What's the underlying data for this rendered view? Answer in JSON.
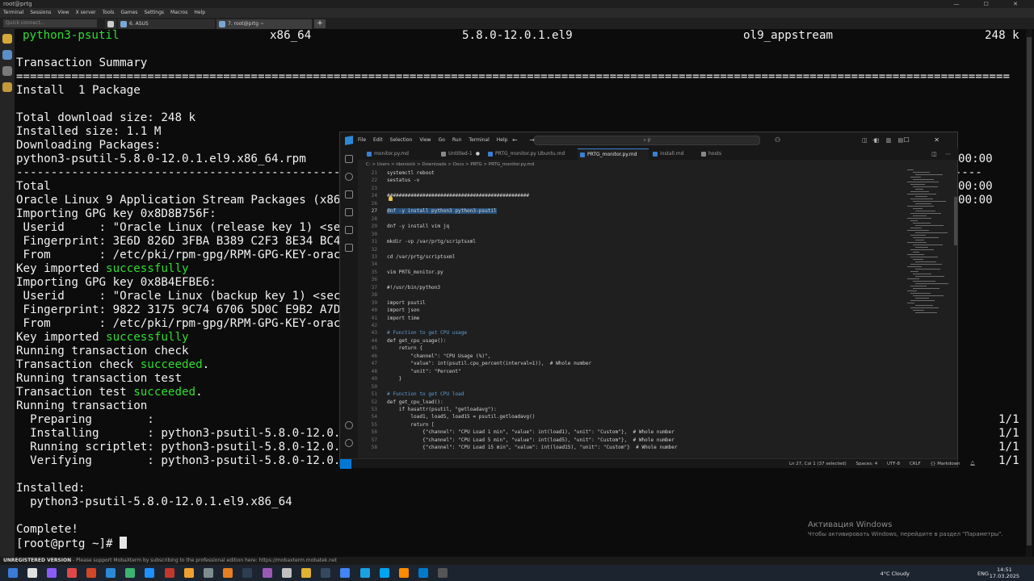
{
  "moba": {
    "title": "root@prtg",
    "menu": [
      "Terminal",
      "Sessions",
      "View",
      "X server",
      "Tools",
      "Games",
      "Settings",
      "Macros",
      "Help"
    ],
    "quick_connect_placeholder": "Quick connect...",
    "tabs": [
      {
        "label": "6. ASUS"
      },
      {
        "label": "7. root@prtg ~"
      }
    ],
    "status_label": "UNREGISTERED VERSION",
    "status_text": "  -  Please support MobaXterm by subscribing to the professional edition here:  https://mobaxterm.mobatek.net"
  },
  "terminal": {
    "pkg_name": "python3-psutil",
    "pkg_arch": "x86_64",
    "pkg_version": "5.8.0-12.0.1.el9",
    "pkg_repo": "ol9_appstream",
    "pkg_size": "248 k",
    "lines": [
      "",
      "Transaction Summary",
      "================================================================================================================================================",
      "Install  1 Package",
      "",
      "Total download size: 248 k",
      "Installed size: 1.1 M",
      "Downloading Packages:",
      "python3-psutil-5.8.0-12.0.1.el9.x86_64.rpm",
      "--------------------------------------------------------------------------------------------------------------------------------------------",
      "Total",
      "Oracle Linux 9 Application Stream Packages (x86",
      "Importing GPG key 0x8D8B756F:",
      " Userid     : \"Oracle Linux (release key 1) <sec",
      " Fingerprint: 3E6D 826D 3FBA B389 C2F3 8E34 BC4",
      " From       : /etc/pki/rpm-gpg/RPM-GPG-KEY-orac",
      "Key imported ",
      "Importing GPG key 0x8B4EFBE6:",
      " Userid     : \"Oracle Linux (backup key 1) <sec",
      " Fingerprint: 9822 3175 9C74 6706 5D0C E9B2 A7D",
      " From       : /etc/pki/rpm-gpg/RPM-GPG-KEY-orac",
      "Key imported ",
      "Running transaction check",
      "Transaction check ",
      "Running transaction test",
      "Transaction test ",
      "Running transaction",
      "  Preparing        :",
      "  Installing       : python3-psutil-5.8.0-12.0.",
      "  Running scriptlet: python3-psutil-5.8.0-12.0.",
      "  Verifying        : python3-psutil-5.8.0-12.0.",
      "",
      "Installed:",
      "  python3-psutil-5.8.0-12.0.1.el9.x86_64",
      "",
      "Complete!",
      "[root@prtg ~]# "
    ],
    "word_successfully": "successfully",
    "word_succeeded": "succeeded",
    "period": ".",
    "right_times": [
      "00:00",
      "00:00",
      "00:00"
    ],
    "right_counts": [
      "1/1",
      "1/1",
      "1/1",
      "1/1"
    ]
  },
  "vscode": {
    "menu": [
      "File",
      "Edit",
      "Selection",
      "View",
      "Go",
      "Run",
      "Terminal",
      "Help"
    ],
    "nav": "← →",
    "search_text": "⌕ p",
    "window_controls": "— ☐ ✕",
    "layout_controls": "◫ ◧ ▥ ▤",
    "tabs": [
      {
        "label": "monitor.py.md",
        "modified": false
      },
      {
        "label": "Untitled-1",
        "modified": true
      },
      {
        "label": "PRTG_monitor.py Ubuntu.md",
        "modified": false
      },
      {
        "label": "PRTG_monitor.py.md",
        "modified": false,
        "active": true
      },
      {
        "label": "install.md",
        "modified": false
      },
      {
        "label": "hosts",
        "modified": false
      }
    ],
    "breadcrumb": "C: > Users > idenisick > Downloads > Docs > PRTG > PRTG_monitor.py.md",
    "code": [
      {
        "n": "21",
        "t": "systemctl reboot",
        "k": ""
      },
      {
        "n": "22",
        "t": "sestatus -v",
        "k": ""
      },
      {
        "n": "23",
        "t": "",
        "k": ""
      },
      {
        "n": "24",
        "t": "################################################",
        "k": ""
      },
      {
        "n": "26",
        "t": "",
        "k": ""
      },
      {
        "n": "27",
        "t": "dnf -y install python3 python3-psutil",
        "k": "sel"
      },
      {
        "n": "28",
        "t": "",
        "k": ""
      },
      {
        "n": "29",
        "t": "dnf -y install vim jq",
        "k": ""
      },
      {
        "n": "30",
        "t": "",
        "k": ""
      },
      {
        "n": "31",
        "t": "mkdir -vp /var/prtg/scriptsxml",
        "k": ""
      },
      {
        "n": "32",
        "t": "",
        "k": ""
      },
      {
        "n": "33",
        "t": "cd /var/prtg/scriptsxml",
        "k": ""
      },
      {
        "n": "34",
        "t": "",
        "k": ""
      },
      {
        "n": "35",
        "t": "vim PRTG_monitor.py",
        "k": ""
      },
      {
        "n": "36",
        "t": "",
        "k": ""
      },
      {
        "n": "37",
        "t": "#!/usr/bin/python3",
        "k": ""
      },
      {
        "n": "38",
        "t": "",
        "k": ""
      },
      {
        "n": "39",
        "t": "import psutil",
        "k": ""
      },
      {
        "n": "40",
        "t": "import json",
        "k": ""
      },
      {
        "n": "41",
        "t": "import time",
        "k": ""
      },
      {
        "n": "42",
        "t": "",
        "k": ""
      },
      {
        "n": "43",
        "t": "# Function to get CPU usage",
        "k": "comment"
      },
      {
        "n": "44",
        "t": "def get_cpu_usage():",
        "k": ""
      },
      {
        "n": "45",
        "t": "    return {",
        "k": ""
      },
      {
        "n": "46",
        "t": "        \"channel\": \"CPU Usage (%)\",",
        "k": ""
      },
      {
        "n": "47",
        "t": "        \"value\": int(psutil.cpu_percent(interval=1)),  # Whole number",
        "k": ""
      },
      {
        "n": "48",
        "t": "        \"unit\": \"Percent\"",
        "k": ""
      },
      {
        "n": "49",
        "t": "    }",
        "k": ""
      },
      {
        "n": "50",
        "t": "",
        "k": ""
      },
      {
        "n": "51",
        "t": "# Function to get CPU load",
        "k": "comment"
      },
      {
        "n": "52",
        "t": "def get_cpu_load():",
        "k": ""
      },
      {
        "n": "53",
        "t": "    if hasattr(psutil, \"getloadavg\"):",
        "k": ""
      },
      {
        "n": "54",
        "t": "        load1, load5, load15 = psutil.getloadavg()",
        "k": ""
      },
      {
        "n": "55",
        "t": "        return [",
        "k": ""
      },
      {
        "n": "56",
        "t": "            {\"channel\": \"CPU Load 1 min\", \"value\": int(load1), \"unit\": \"Custom\"},  # Whole number",
        "k": ""
      },
      {
        "n": "57",
        "t": "            {\"channel\": \"CPU Load 5 min\", \"value\": int(load5), \"unit\": \"Custom\"},  # Whole number",
        "k": ""
      },
      {
        "n": "58",
        "t": "            {\"channel\": \"CPU Load 15 min\", \"value\": int(load15), \"unit\": \"Custom\"}  # Whole number",
        "k": ""
      }
    ],
    "status": {
      "position": "Ln 27, Col 1 (37 selected)",
      "spaces": "Spaces: 4",
      "encoding": "UTF-8",
      "eol": "CRLF",
      "language": "{} Markdown"
    }
  },
  "watermark": {
    "title": "Активация Windows",
    "subtitle": "Чтобы активировать Windows, перейдите в раздел \"Параметры\"."
  },
  "taskbar": {
    "weather": "4°C  Cloudy",
    "lang": "ENG",
    "time": "14:51",
    "date": "17.03.2025"
  },
  "colors": {
    "terminal_bg": "#0c0c0c",
    "terminal_green": "#2fdc2f",
    "vscode_bg": "#1f1f1f",
    "selection": "#264f78",
    "accent": "#0078d4"
  }
}
